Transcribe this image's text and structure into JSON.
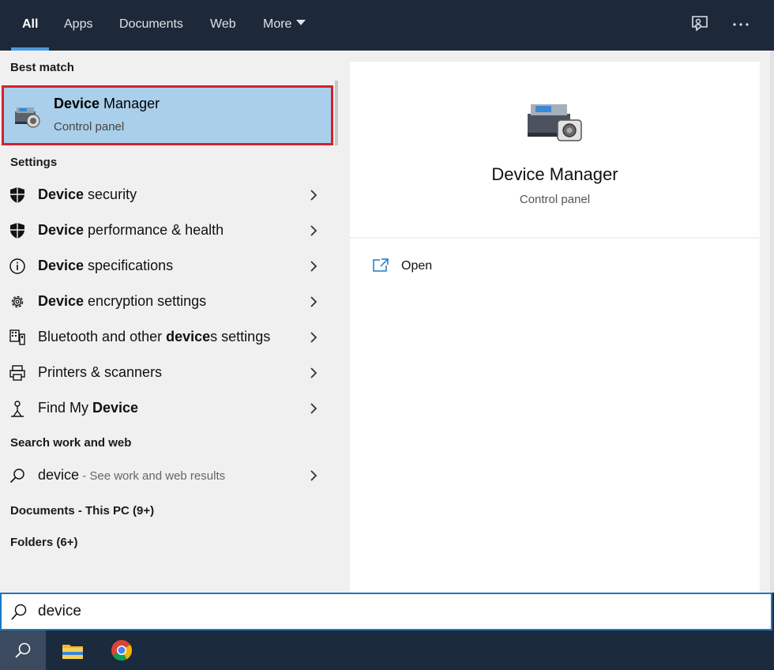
{
  "tabs": [
    {
      "label": "All",
      "active": true
    },
    {
      "label": "Apps"
    },
    {
      "label": "Documents"
    },
    {
      "label": "Web"
    },
    {
      "label": "More"
    }
  ],
  "top_icons": [
    "feedback-icon",
    "more-options-icon"
  ],
  "sections": {
    "best_match": "Best match",
    "settings": "Settings",
    "search_web": "Search work and web",
    "documents": "Documents - This PC (9+)",
    "folders": "Folders (6+)"
  },
  "best_match": {
    "title_bold": "Device",
    "title_rest": " Manager",
    "subtitle": "Control panel"
  },
  "settings_items": [
    {
      "pre": "",
      "bold": "Device",
      "post": " security",
      "icon": "shield-icon"
    },
    {
      "pre": "",
      "bold": "Device",
      "post": " performance & health",
      "icon": "shield-icon"
    },
    {
      "pre": "",
      "bold": "Device",
      "post": " specifications",
      "icon": "info-icon"
    },
    {
      "pre": "",
      "bold": "Device",
      "post": " encryption settings",
      "icon": "gear-icon"
    },
    {
      "pre": "Bluetooth and other ",
      "bold": "device",
      "post": "s settings",
      "icon": "keyboard-devices-icon"
    },
    {
      "pre": "Printers & scanners",
      "bold": "",
      "post": "",
      "icon": "printer-icon"
    },
    {
      "pre": "Find My ",
      "bold": "Device",
      "post": "",
      "icon": "person-location-icon"
    }
  ],
  "web_result": {
    "query": "device",
    "hint": " - See work and web results"
  },
  "preview": {
    "title": "Device Manager",
    "subtitle": "Control panel",
    "open_label": "Open"
  },
  "search": {
    "value": "device"
  },
  "colors": {
    "accent": "#1a78c2",
    "highlight": "#a9cfea",
    "selection_border": "#d7202a",
    "topbar": "#1d2838"
  }
}
